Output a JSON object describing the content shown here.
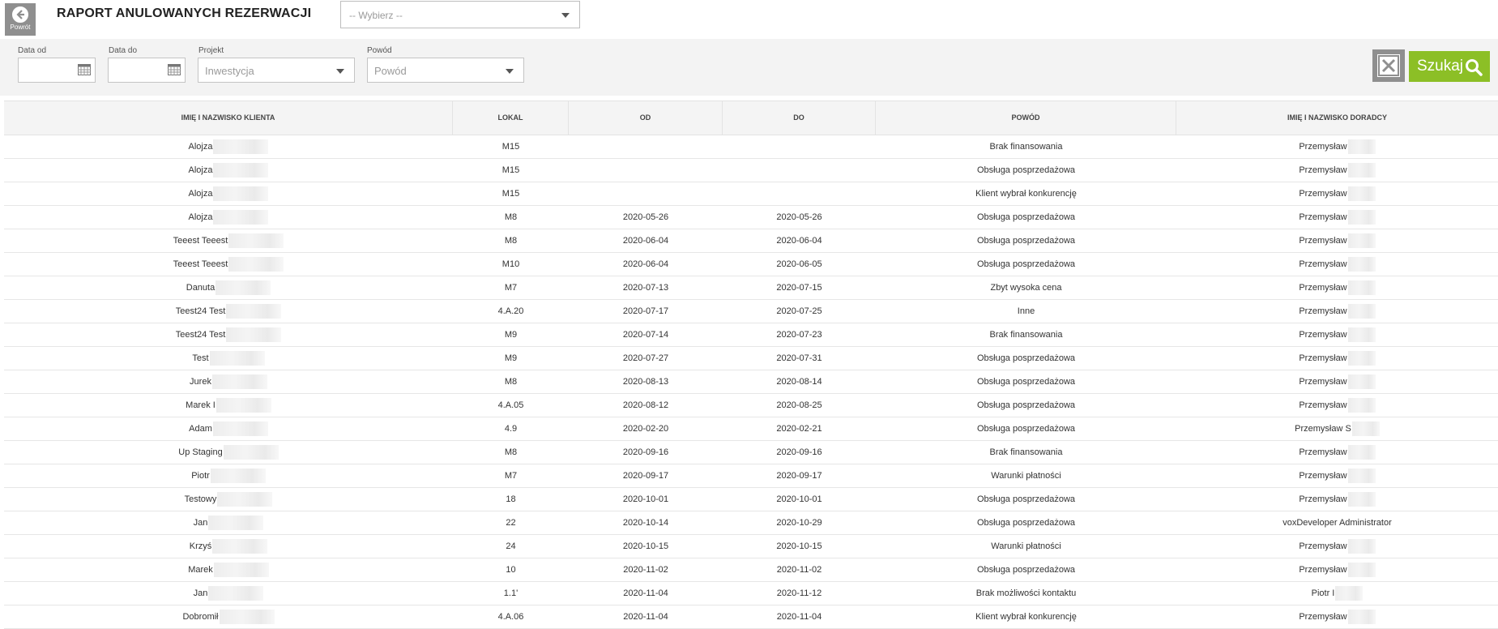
{
  "header": {
    "back_label": "Powrót",
    "title": "RAPORT ANULOWANYCH REZERWACJI",
    "select_value": "-- Wybierz --"
  },
  "filters": {
    "date_from_label": "Data od",
    "date_to_label": "Data do",
    "project_label": "Projekt",
    "project_placeholder": "Inwestycja",
    "reason_label": "Powód",
    "reason_placeholder": "Powód",
    "search_label": "Szukaj"
  },
  "colors": {
    "accent": "#8cbf26",
    "button_gray": "#8f8f8f"
  },
  "table": {
    "columns": [
      "IMIĘ I NAZWISKO KLIENTA",
      "LOKAL",
      "OD",
      "DO",
      "POWÓD",
      "IMIĘ I NAZWISKO DORADCY"
    ],
    "rows": [
      {
        "client": "Alojza",
        "lokal": "M15",
        "od": "",
        "do": "",
        "powod": "Brak finansowania",
        "doradca": "Przemysław"
      },
      {
        "client": "Alojza",
        "lokal": "M15",
        "od": "",
        "do": "",
        "powod": "Obsługa posprzedażowa",
        "doradca": "Przemysław"
      },
      {
        "client": "Alojza",
        "lokal": "M15",
        "od": "",
        "do": "",
        "powod": "Klient wybrał konkurencję",
        "doradca": "Przemysław"
      },
      {
        "client": "Alojza",
        "lokal": "M8",
        "od": "2020-05-26",
        "do": "2020-05-26",
        "powod": "Obsługa posprzedażowa",
        "doradca": "Przemysław"
      },
      {
        "client": "Teeest Teeest",
        "lokal": "M8",
        "od": "2020-06-04",
        "do": "2020-06-04",
        "powod": "Obsługa posprzedażowa",
        "doradca": "Przemysław"
      },
      {
        "client": "Teeest Teeest",
        "lokal": "M10",
        "od": "2020-06-04",
        "do": "2020-06-05",
        "powod": "Obsługa posprzedażowa",
        "doradca": "Przemysław"
      },
      {
        "client": "Danuta",
        "lokal": "M7",
        "od": "2020-07-13",
        "do": "2020-07-15",
        "powod": "Zbyt wysoka cena",
        "doradca": "Przemysław"
      },
      {
        "client": "Teest24 Test",
        "lokal": "4.A.20",
        "od": "2020-07-17",
        "do": "2020-07-25",
        "powod": "Inne",
        "doradca": "Przemysław"
      },
      {
        "client": "Teest24 Test",
        "lokal": "M9",
        "od": "2020-07-14",
        "do": "2020-07-23",
        "powod": "Brak finansowania",
        "doradca": "Przemysław"
      },
      {
        "client": "Test",
        "lokal": "M9",
        "od": "2020-07-27",
        "do": "2020-07-31",
        "powod": "Obsługa posprzedażowa",
        "doradca": "Przemysław"
      },
      {
        "client": "Jurek",
        "lokal": "M8",
        "od": "2020-08-13",
        "do": "2020-08-14",
        "powod": "Obsługa posprzedażowa",
        "doradca": "Przemysław"
      },
      {
        "client": "Marek I",
        "lokal": "4.A.05",
        "od": "2020-08-12",
        "do": "2020-08-25",
        "powod": "Obsługa posprzedażowa",
        "doradca": "Przemysław"
      },
      {
        "client": "Adam",
        "lokal": "4.9",
        "od": "2020-02-20",
        "do": "2020-02-21",
        "powod": "Obsługa posprzedażowa",
        "doradca": "Przemysław S"
      },
      {
        "client": "Up Staging",
        "lokal": "M8",
        "od": "2020-09-16",
        "do": "2020-09-16",
        "powod": "Brak finansowania",
        "doradca": "Przemysław"
      },
      {
        "client": "Piotr",
        "lokal": "M7",
        "od": "2020-09-17",
        "do": "2020-09-17",
        "powod": "Warunki płatności",
        "doradca": "Przemysław"
      },
      {
        "client": "Testowy",
        "lokal": "18",
        "od": "2020-10-01",
        "do": "2020-10-01",
        "powod": "Obsługa posprzedażowa",
        "doradca": "Przemysław"
      },
      {
        "client": "Jan",
        "lokal": "22",
        "od": "2020-10-14",
        "do": "2020-10-29",
        "powod": "Obsługa posprzedażowa",
        "doradca": "voxDeveloper Administrator"
      },
      {
        "client": "Krzyś",
        "lokal": "24",
        "od": "2020-10-15",
        "do": "2020-10-15",
        "powod": "Warunki płatności",
        "doradca": "Przemysław"
      },
      {
        "client": "Marek",
        "lokal": "10",
        "od": "2020-11-02",
        "do": "2020-11-02",
        "powod": "Obsługa posprzedażowa",
        "doradca": "Przemysław"
      },
      {
        "client": "Jan",
        "lokal": "1.1'",
        "od": "2020-11-04",
        "do": "2020-11-12",
        "powod": "Brak możliwości kontaktu",
        "doradca": "Piotr I"
      },
      {
        "client": "Dobromił",
        "lokal": "4.A.06",
        "od": "2020-11-04",
        "do": "2020-11-04",
        "powod": "Klient wybrał konkurencję",
        "doradca": "Przemysław"
      }
    ]
  }
}
